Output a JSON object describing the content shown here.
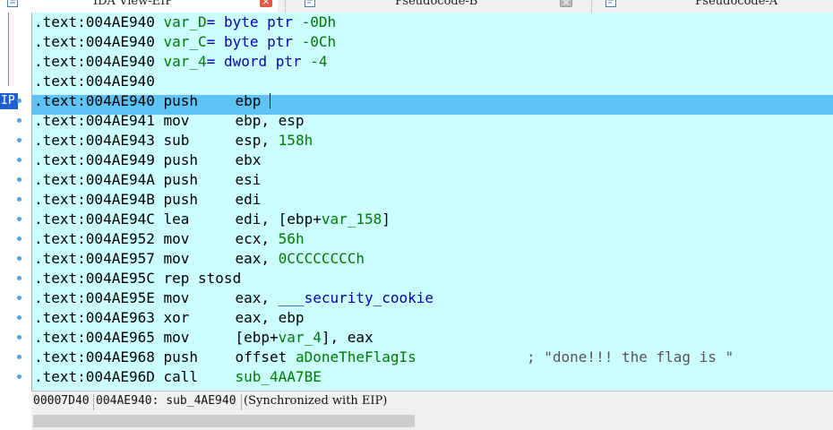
{
  "tabs": [
    {
      "label": "IDA View-EIP",
      "active": true,
      "closable": true,
      "icon": "listing-icon"
    },
    {
      "label": "Pseudocode-B",
      "active": false,
      "closable": true,
      "icon": "pseudocode-icon"
    },
    {
      "label": "Pseudocode-A",
      "active": false,
      "closable": false,
      "icon": "pseudocode-icon"
    }
  ],
  "ip_marker": "IP",
  "lines": [
    {
      "addr": ".text:004AE940",
      "var": "var_D",
      "eq": "= byte ptr ",
      "off": "-0Dh"
    },
    {
      "addr": ".text:004AE940",
      "var": "var_C",
      "eq": "= byte ptr ",
      "off": "-0Ch"
    },
    {
      "addr": ".text:004AE940",
      "var": "var_4",
      "eq": "= dword ptr ",
      "off": "-4"
    },
    {
      "addr": ".text:004AE940"
    },
    {
      "addr": ".text:004AE940",
      "mn": "push",
      "op": "ebp",
      "current": true
    },
    {
      "addr": ".text:004AE941",
      "mn": "mov",
      "op": "ebp, esp"
    },
    {
      "addr": ".text:004AE943",
      "mn": "sub",
      "op": "esp, ",
      "opg": "158h"
    },
    {
      "addr": ".text:004AE949",
      "mn": "push",
      "op": "ebx"
    },
    {
      "addr": ".text:004AE94A",
      "mn": "push",
      "op": "esi"
    },
    {
      "addr": ".text:004AE94B",
      "mn": "push",
      "op": "edi"
    },
    {
      "addr": ".text:004AE94C",
      "mn": "lea",
      "op": "edi, [ebp+",
      "opg": "var_158",
      "op2": "]"
    },
    {
      "addr": ".text:004AE952",
      "mn": "mov",
      "op": "ecx, ",
      "opg": "56h"
    },
    {
      "addr": ".text:004AE957",
      "mn": "mov",
      "op": "eax, ",
      "opg": "0CCCCCCCCh"
    },
    {
      "addr": ".text:004AE95C",
      "mn": "rep stosd",
      "op": ""
    },
    {
      "addr": ".text:004AE95E",
      "mn": "mov",
      "op": "eax, ",
      "opb": "___security_cookie"
    },
    {
      "addr": ".text:004AE963",
      "mn": "xor",
      "op": "eax, ebp"
    },
    {
      "addr": ".text:004AE965",
      "mn": "mov",
      "op": "[ebp+",
      "opg": "var_4",
      "op2": "], eax"
    },
    {
      "addr": ".text:004AE968",
      "mn": "push",
      "op": "offset ",
      "opg": "aDoneTheFlagIs",
      "comment": "; \"done!!! the flag is \""
    },
    {
      "addr": ".text:004AE96D",
      "mn": "call",
      "op": "",
      "opg": "sub_4AA7BE"
    }
  ],
  "status": {
    "offset": "00007D40",
    "location": "004AE940: sub_4AE940",
    "sync": "(Synchronized with EIP)"
  },
  "colors": {
    "listing_bg": "#ccffff",
    "highlight": "#5dc3f5",
    "names": "#007a00",
    "imports": "#0000b4",
    "ip_marker": "#1e5fd1",
    "close_button": "#e05a4a"
  }
}
